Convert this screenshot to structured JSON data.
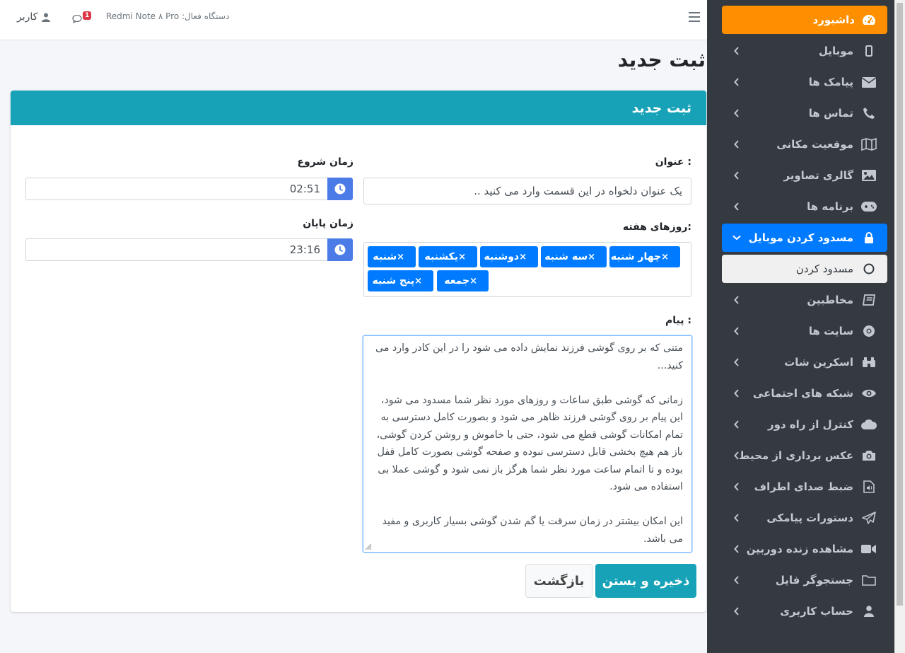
{
  "topbar": {
    "device_label": "دستگاه فعال: Redmi Note ۸ Pro",
    "notification_count": "1",
    "user_label": "کاربر"
  },
  "page": {
    "title": "ثبت جدید"
  },
  "card": {
    "header": "ثبت جدید"
  },
  "form": {
    "title_label": "عنوان :",
    "title_placeholder": "یک عنوان دلخواه در این قسمت وارد می کنید ..",
    "start_label": "زمان شروع",
    "start_value": "02:51",
    "end_label": "زمان پایان",
    "end_value": "23:16",
    "days_label": "روزهای هفته:",
    "days": [
      "چهار شنبه",
      "سه شنبه",
      "دوشنبه",
      "یکشنبه",
      "شنبه",
      "پنج شنبه",
      "جمعه"
    ],
    "tag_remove": "×",
    "message_label": "پیام :",
    "message_value": "متنی که بر روی گوشی فرزند نمایش داده می شود را در این کادر وارد می کنید...\n\nزمانی که گوشی طبق ساعات و روزهای مورد نظر شما مسدود می شود، این پیام بر روی گوشی فرزند ظاهر می شود و بصورت کامل دسترسی به تمام امکانات گوشی قطع می شود، حتی با خاموش و روشن کردن گوشی، باز هم هیچ بخشی قابل دسترسی نبوده و صفحه گوشی بصورت کامل قفل بوده و تا اتمام ساعت مورد نظر شما هرگز باز نمی شود و گوشی عملا بی استفاده می شود.\n\nاین امکان بیشتر در زمان سرقت یا گم شدن گوشی بسیار کاربری و مفید می باشد.",
    "save_label": "ذخیره و بستن",
    "back_label": "بازگشت"
  },
  "sidebar": {
    "items": [
      {
        "label": "داشبورد",
        "icon": "dashboard-icon"
      },
      {
        "label": "موبایل",
        "icon": "mobile-icon"
      },
      {
        "label": "پیامک ها",
        "icon": "envelope-icon"
      },
      {
        "label": "تماس ها",
        "icon": "phone-icon"
      },
      {
        "label": "موقعیت مکانی",
        "icon": "map-icon"
      },
      {
        "label": "گالری تصاویر",
        "icon": "image-icon"
      },
      {
        "label": "برنامه ها",
        "icon": "gamepad-icon"
      },
      {
        "label": "مسدود کردن موبایل",
        "icon": "lock-icon"
      },
      {
        "label": "مسدود کردن",
        "icon": "circle-icon"
      },
      {
        "label": "مخاطبین",
        "icon": "book-icon"
      },
      {
        "label": "سایت ها",
        "icon": "chrome-icon"
      },
      {
        "label": "اسکرین شات",
        "icon": "binoculars-icon"
      },
      {
        "label": "شبکه های اجتماعی",
        "icon": "eye-icon"
      },
      {
        "label": "کنترل از راه دور",
        "icon": "cloud-icon"
      },
      {
        "label": "عکس برداری از محیط",
        "icon": "camera-icon"
      },
      {
        "label": "ضبط صدای اطراف",
        "icon": "audio-file-icon"
      },
      {
        "label": "دستورات پیامکی",
        "icon": "paper-plane-icon"
      },
      {
        "label": "مشاهده زنده دوربین",
        "icon": "video-icon"
      },
      {
        "label": "جستجوگر فایل",
        "icon": "folder-icon"
      },
      {
        "label": "حساب کاربری",
        "icon": "user-icon"
      }
    ]
  },
  "colors": {
    "sidebar_bg": "#343a40",
    "dashboard_active": "#fd8f00",
    "menu_active": "#007bff",
    "card_header": "#17a2b8",
    "time_button": "#4a7be6"
  }
}
